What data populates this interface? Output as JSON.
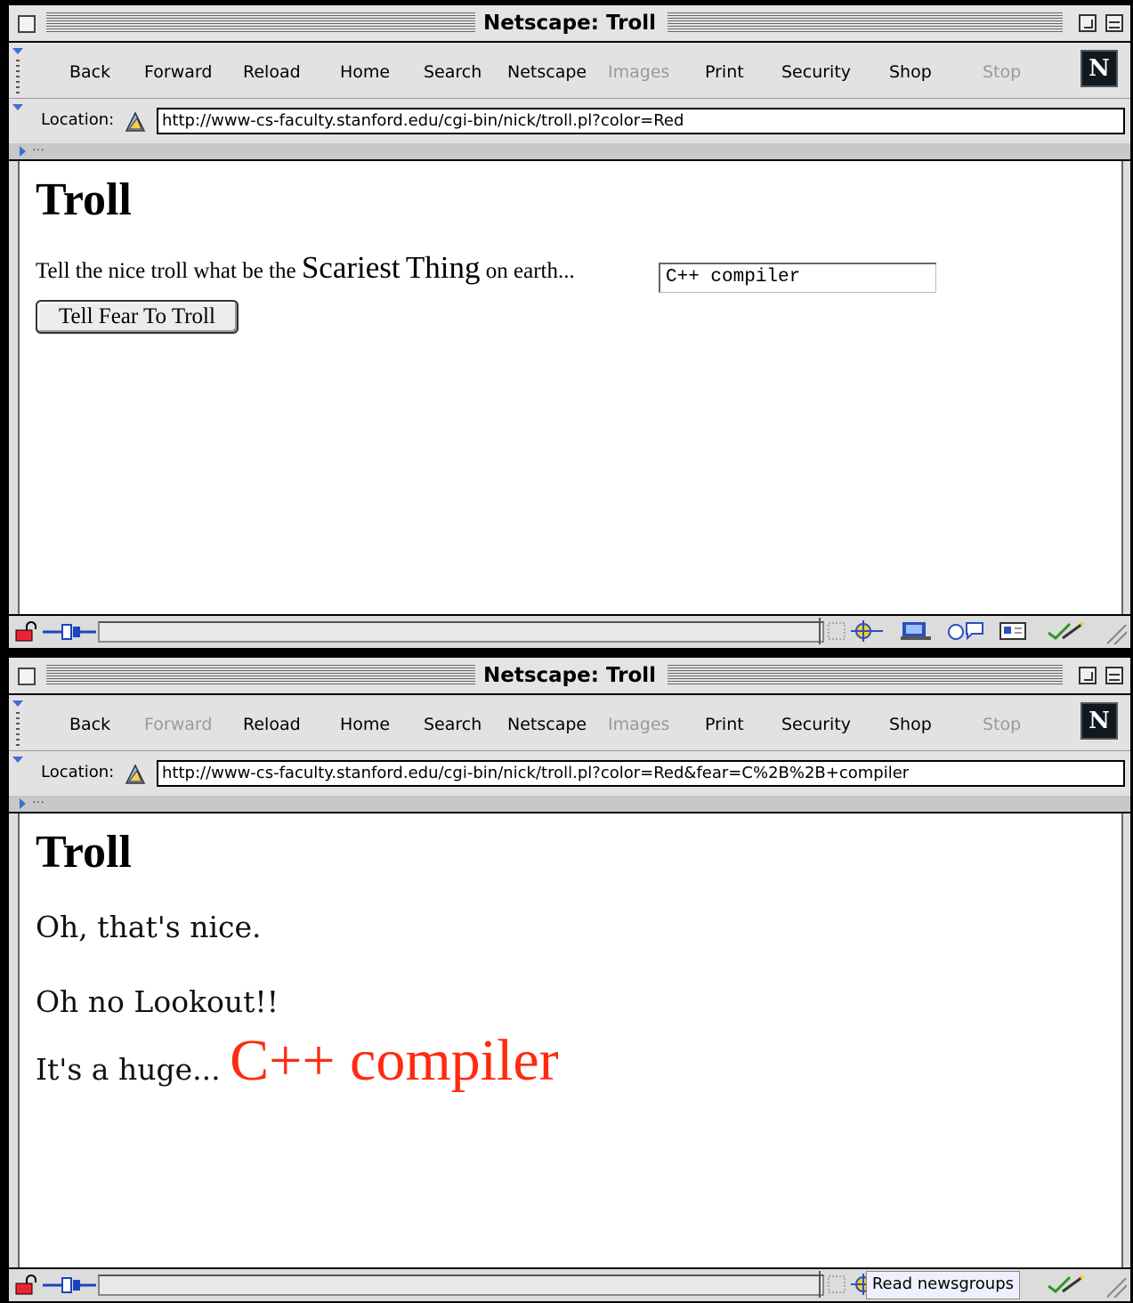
{
  "windows": [
    {
      "title": "Netscape: Troll",
      "toolbar": {
        "back": "Back",
        "forward": "Forward",
        "reload": "Reload",
        "home": "Home",
        "search": "Search",
        "netscape": "Netscape",
        "images": "Images",
        "print": "Print",
        "security": "Security",
        "shop": "Shop",
        "stop": "Stop"
      },
      "location_label": "Location:",
      "url": "http://www-cs-faculty.stanford.edu/cgi-bin/nick/troll.pl?color=Red",
      "page": {
        "heading": "Troll",
        "prompt_part1": "Tell the nice troll what be the ",
        "prompt_big1": "Scariest",
        "prompt_big2": "Thing",
        "prompt_part2": " on earth...",
        "fear_value": "C++ compiler",
        "submit_label": "Tell Fear To Troll"
      }
    },
    {
      "title": "Netscape: Troll",
      "toolbar": {
        "back": "Back",
        "forward": "Forward",
        "reload": "Reload",
        "home": "Home",
        "search": "Search",
        "netscape": "Netscape",
        "images": "Images",
        "print": "Print",
        "security": "Security",
        "shop": "Shop",
        "stop": "Stop"
      },
      "location_label": "Location:",
      "url": "http://www-cs-faculty.stanford.edu/cgi-bin/nick/troll.pl?color=Red&fear=C%2B%2B+compiler",
      "page": {
        "heading": "Troll",
        "reply1": "Oh, that's nice.",
        "reply2": "Oh no Lookout!!",
        "reply3_prefix": "It's a huge... ",
        "monster": "C++ compiler"
      },
      "tooltip": "Read newsgroups"
    }
  ],
  "colors": {
    "monster": "#ff2a0f",
    "toolbar_accent": "#3a6fd0"
  }
}
